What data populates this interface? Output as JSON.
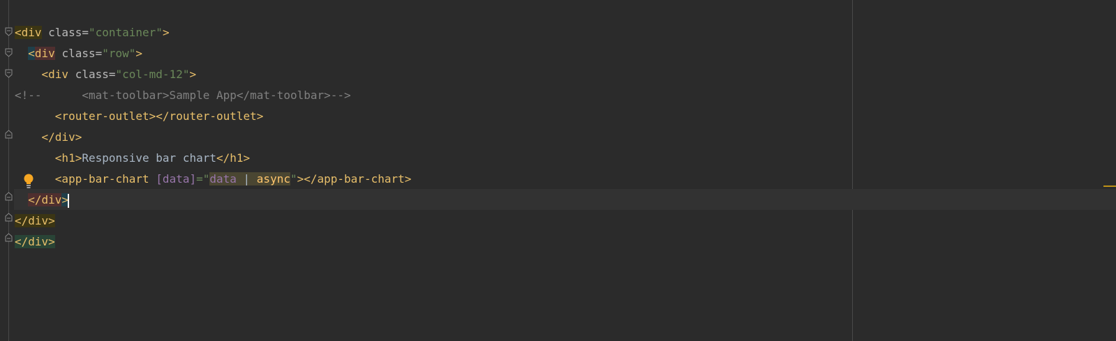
{
  "lines": [
    {
      "t1": "<div",
      "t2": " class=",
      "t3": "\"container\"",
      "t4": ">"
    },
    {
      "t1": "<div",
      "t2": " class=",
      "t3": "\"row\"",
      "t4": ">"
    },
    {
      "t1": "<div",
      "t2": " class=",
      "t3": "\"col-md-12\"",
      "t4": ">"
    },
    {
      "t1": "<!--      <mat-toolbar>Sample App</mat-toolbar>-->"
    },
    {
      "t1": "<router-outlet></router-outlet>"
    },
    {
      "t1": "</div>"
    },
    {
      "t1": "<h1>",
      "t2": "Responsive bar chart",
      "t3": "</h1>"
    },
    {
      "t1": "<app-bar-chart ",
      "t2": "[data]",
      "t3": "=\"",
      "t4": "data",
      "t5": " | ",
      "t6": "async",
      "t7": "\"",
      "t8": "></app-bar-chart>"
    },
    {
      "t1": "</div",
      "t2": ">"
    },
    {
      "t1": "</div>"
    },
    {
      "t1": "</div>"
    }
  ],
  "icons": {
    "fold_open": "fold-open-icon",
    "fold_close": "fold-close-icon",
    "bulb": "lightbulb-icon"
  },
  "colors": {
    "background": "#2b2b2b",
    "tag": "#e8bf6a",
    "string": "#6a8759",
    "comment": "#808080",
    "angular_attr": "#9876aa",
    "bulb": "#f5a623"
  }
}
